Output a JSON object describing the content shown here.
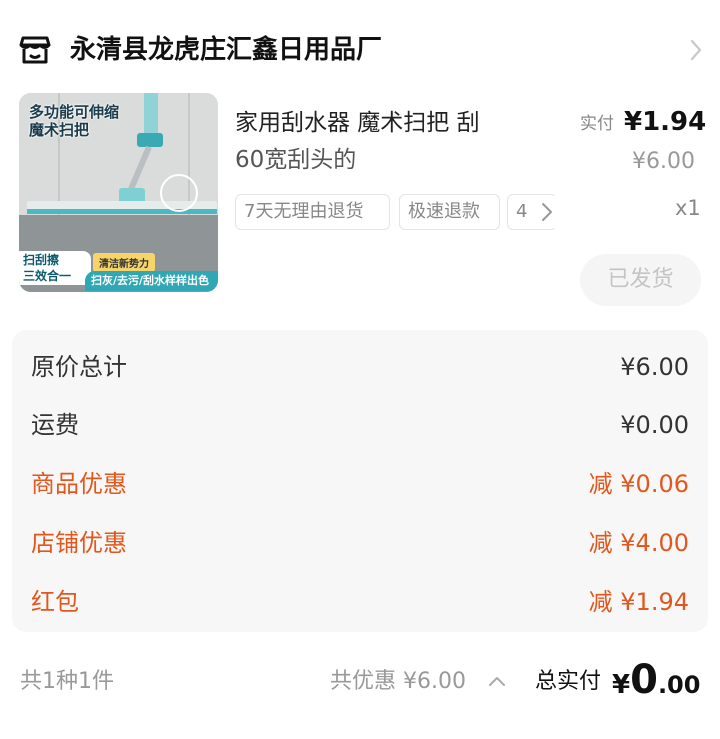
{
  "shop": {
    "name": "永清县龙虎庄汇鑫日用品厂",
    "icon": "shop-icon",
    "arrow": "chevron-right-icon"
  },
  "product": {
    "image": {
      "title_line1": "多功能可伸缩",
      "title_line2": "魔术扫把",
      "badge_line1": "扫刮擦",
      "badge_line2": "三效合一",
      "tag": "清洁新势力",
      "strip": "扫灰/去污/刮水样样出色"
    },
    "title_line1": "家用刮水器 魔术扫把 刮",
    "title_line2": "60宽刮头的",
    "service_tags": [
      "7天无理由退货",
      "极速退款",
      "4"
    ],
    "price_label": "实付",
    "price_actual": "¥1.94",
    "price_original": "¥6.00",
    "quantity": "x1",
    "status_button": "已发货"
  },
  "costs": {
    "original_total_label": "原价总计",
    "original_total_value": "¥6.00",
    "shipping_label": "运费",
    "shipping_value": "¥0.00",
    "product_discount_label": "商品优惠",
    "product_discount_value": "减 ¥0.06",
    "shop_discount_label": "店铺优惠",
    "shop_discount_value": "减 ¥4.00",
    "red_packet_label": "红包",
    "red_packet_value": "减 ¥1.94"
  },
  "footer": {
    "count": "共1种1件",
    "discount_total": "共优惠 ¥6.00",
    "total_label": "总实付",
    "total_currency": "¥",
    "total_integer": "0",
    "total_decimal": ".00"
  },
  "colors": {
    "discount": "#e2571d",
    "accent_teal": "#2fa7b5"
  }
}
